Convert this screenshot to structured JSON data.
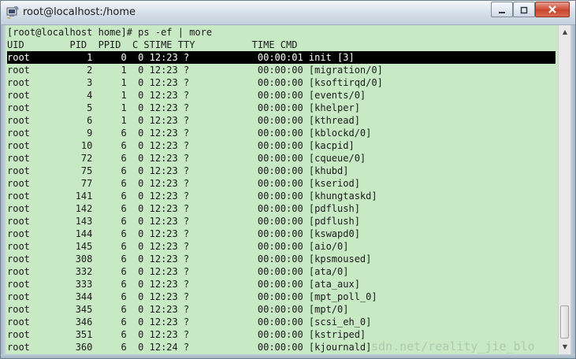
{
  "window": {
    "title": "root@localhost:/home",
    "terminal_bg": "#c7e9c4",
    "highlight_bg": "#000000",
    "highlight_fg": "#ffffff"
  },
  "icons": {
    "app": "terminal-app-icon",
    "minimize": "minimize-icon",
    "maximize": "maximize-icon",
    "close": "close-icon"
  },
  "terminal": {
    "command_line": "[root@localhost home]# ps -ef | more",
    "header": "UID        PID  PPID  C STIME TTY          TIME CMD",
    "processes": [
      {
        "uid": "root",
        "pid": "1",
        "ppid": "0",
        "c": "0",
        "stime": "12:23",
        "tty": "?",
        "time": "00:00:01",
        "cmd": "init [3]"
      },
      {
        "uid": "root",
        "pid": "2",
        "ppid": "1",
        "c": "0",
        "stime": "12:23",
        "tty": "?",
        "time": "00:00:00",
        "cmd": "[migration/0]"
      },
      {
        "uid": "root",
        "pid": "3",
        "ppid": "1",
        "c": "0",
        "stime": "12:23",
        "tty": "?",
        "time": "00:00:00",
        "cmd": "[ksoftirqd/0]"
      },
      {
        "uid": "root",
        "pid": "4",
        "ppid": "1",
        "c": "0",
        "stime": "12:23",
        "tty": "?",
        "time": "00:00:00",
        "cmd": "[events/0]"
      },
      {
        "uid": "root",
        "pid": "5",
        "ppid": "1",
        "c": "0",
        "stime": "12:23",
        "tty": "?",
        "time": "00:00:00",
        "cmd": "[khelper]"
      },
      {
        "uid": "root",
        "pid": "6",
        "ppid": "1",
        "c": "0",
        "stime": "12:23",
        "tty": "?",
        "time": "00:00:00",
        "cmd": "[kthread]"
      },
      {
        "uid": "root",
        "pid": "9",
        "ppid": "6",
        "c": "0",
        "stime": "12:23",
        "tty": "?",
        "time": "00:00:00",
        "cmd": "[kblockd/0]"
      },
      {
        "uid": "root",
        "pid": "10",
        "ppid": "6",
        "c": "0",
        "stime": "12:23",
        "tty": "?",
        "time": "00:00:00",
        "cmd": "[kacpid]"
      },
      {
        "uid": "root",
        "pid": "72",
        "ppid": "6",
        "c": "0",
        "stime": "12:23",
        "tty": "?",
        "time": "00:00:00",
        "cmd": "[cqueue/0]"
      },
      {
        "uid": "root",
        "pid": "75",
        "ppid": "6",
        "c": "0",
        "stime": "12:23",
        "tty": "?",
        "time": "00:00:00",
        "cmd": "[khubd]"
      },
      {
        "uid": "root",
        "pid": "77",
        "ppid": "6",
        "c": "0",
        "stime": "12:23",
        "tty": "?",
        "time": "00:00:00",
        "cmd": "[kseriod]"
      },
      {
        "uid": "root",
        "pid": "141",
        "ppid": "6",
        "c": "0",
        "stime": "12:23",
        "tty": "?",
        "time": "00:00:00",
        "cmd": "[khungtaskd]"
      },
      {
        "uid": "root",
        "pid": "142",
        "ppid": "6",
        "c": "0",
        "stime": "12:23",
        "tty": "?",
        "time": "00:00:00",
        "cmd": "[pdflush]"
      },
      {
        "uid": "root",
        "pid": "143",
        "ppid": "6",
        "c": "0",
        "stime": "12:23",
        "tty": "?",
        "time": "00:00:00",
        "cmd": "[pdflush]"
      },
      {
        "uid": "root",
        "pid": "144",
        "ppid": "6",
        "c": "0",
        "stime": "12:23",
        "tty": "?",
        "time": "00:00:00",
        "cmd": "[kswapd0]"
      },
      {
        "uid": "root",
        "pid": "145",
        "ppid": "6",
        "c": "0",
        "stime": "12:23",
        "tty": "?",
        "time": "00:00:00",
        "cmd": "[aio/0]"
      },
      {
        "uid": "root",
        "pid": "308",
        "ppid": "6",
        "c": "0",
        "stime": "12:23",
        "tty": "?",
        "time": "00:00:00",
        "cmd": "[kpsmoused]"
      },
      {
        "uid": "root",
        "pid": "332",
        "ppid": "6",
        "c": "0",
        "stime": "12:23",
        "tty": "?",
        "time": "00:00:00",
        "cmd": "[ata/0]"
      },
      {
        "uid": "root",
        "pid": "333",
        "ppid": "6",
        "c": "0",
        "stime": "12:23",
        "tty": "?",
        "time": "00:00:00",
        "cmd": "[ata_aux]"
      },
      {
        "uid": "root",
        "pid": "344",
        "ppid": "6",
        "c": "0",
        "stime": "12:23",
        "tty": "?",
        "time": "00:00:00",
        "cmd": "[mpt_poll_0]"
      },
      {
        "uid": "root",
        "pid": "345",
        "ppid": "6",
        "c": "0",
        "stime": "12:23",
        "tty": "?",
        "time": "00:00:00",
        "cmd": "[mpt/0]"
      },
      {
        "uid": "root",
        "pid": "346",
        "ppid": "6",
        "c": "0",
        "stime": "12:23",
        "tty": "?",
        "time": "00:00:00",
        "cmd": "[scsi_eh_0]"
      },
      {
        "uid": "root",
        "pid": "351",
        "ppid": "6",
        "c": "0",
        "stime": "12:23",
        "tty": "?",
        "time": "00:00:00",
        "cmd": "[kstriped]"
      },
      {
        "uid": "root",
        "pid": "360",
        "ppid": "6",
        "c": "0",
        "stime": "12:24",
        "tty": "?",
        "time": "00:00:00",
        "cmd": "[kjournald]"
      }
    ]
  },
  "scrollbar": {
    "up_arrow": "▲",
    "down_arrow": "▼"
  },
  "watermark": "sdn.net/reality_jie_blo"
}
